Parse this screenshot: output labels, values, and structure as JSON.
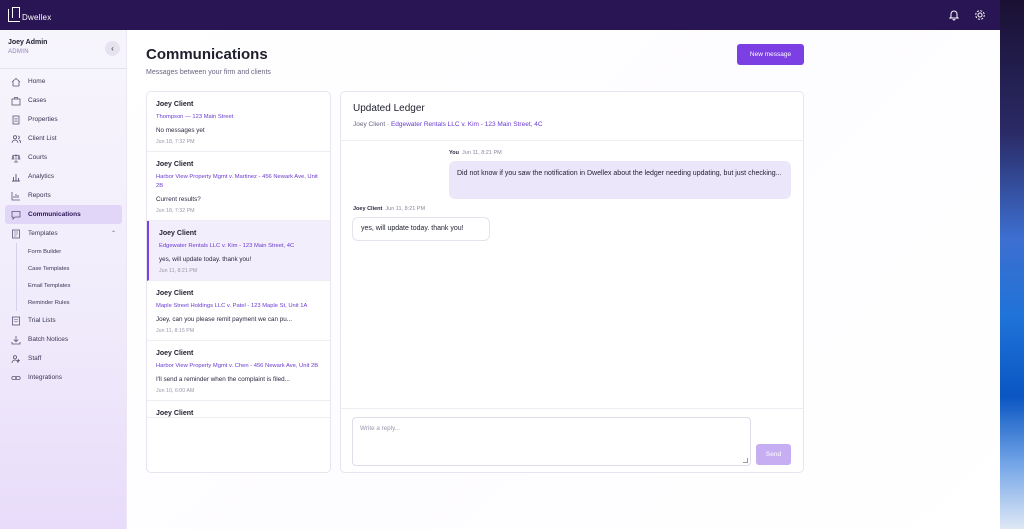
{
  "app": {
    "logo_text": "Dwellex"
  },
  "user": {
    "name": "Joey Admin",
    "role": "ADMIN"
  },
  "nav": {
    "items": [
      {
        "label": "Home",
        "icon": "home-icon"
      },
      {
        "label": "Cases",
        "icon": "briefcase-icon"
      },
      {
        "label": "Properties",
        "icon": "document-icon"
      },
      {
        "label": "Client List",
        "icon": "users-icon"
      },
      {
        "label": "Courts",
        "icon": "scale-icon"
      },
      {
        "label": "Analytics",
        "icon": "bar-chart-icon"
      },
      {
        "label": "Reports",
        "icon": "report-chart-icon"
      },
      {
        "label": "Communications",
        "icon": "chat-icon"
      },
      {
        "label": "Templates",
        "icon": "template-icon"
      }
    ],
    "sub_items": [
      "Form Builder",
      "Case Templates",
      "Email Templates",
      "Reminder Rules"
    ],
    "bottom_items": [
      {
        "label": "Trial Lists",
        "icon": "list-icon"
      },
      {
        "label": "Batch Notices",
        "icon": "download-icon"
      },
      {
        "label": "Staff",
        "icon": "staff-icon"
      },
      {
        "label": "Integrations",
        "icon": "link-icon"
      }
    ]
  },
  "page": {
    "title": "Communications",
    "subtitle": "Messages between your firm and clients",
    "new_message_label": "New message"
  },
  "threads": [
    {
      "name": "Joey Client",
      "case": "Thompson — 123 Main Street",
      "preview": "No messages yet",
      "time": "Jun 18, 7:32 PM"
    },
    {
      "name": "Joey Client",
      "case": "Harbor View Property Mgmt v. Martinez - 456 Newark Ave, Unit 2B",
      "preview": "Current results?",
      "time": "Jun 18, 7:32 PM"
    },
    {
      "name": "Joey Client",
      "case": "Edgewater Rentals LLC v. Kim - 123 Main Street, 4C",
      "preview": "yes, will update today. thank you!",
      "time": "Jun 11, 8:21 PM"
    },
    {
      "name": "Joey Client",
      "case": "Maple Street Holdings LLC v. Patel - 123 Maple St, Unit 1A",
      "preview": "Joey, can you please remit payment we can pu...",
      "time": "Jun 11, 8:15 PM"
    },
    {
      "name": "Joey Client",
      "case": "Harbor View Property Mgmt v. Chen - 456 Newark Ave, Unit 2B",
      "preview": "I'll send a reminder when the complaint is filed...",
      "time": "Jun 10, 6:00 AM"
    },
    {
      "name": "Joey Client",
      "case": "",
      "preview": "",
      "time": ""
    }
  ],
  "conversation": {
    "title": "Updated Ledger",
    "client": "Joey Client",
    "separator": " · ",
    "case": "Edgewater Rentals LLC v. Kim - 123 Main Street, 4C",
    "messages": [
      {
        "sender": "You",
        "time": "Jun 11, 8:21 PM",
        "text": "Did not know if you saw the notification in Dwellex about the ledger needing updating, but just checking..."
      },
      {
        "sender": "Joey Client",
        "time": "Jun 11, 8:21 PM",
        "text": "yes, will update today. thank you!"
      }
    ],
    "reply_placeholder": "Write a reply...",
    "send_label": "Send"
  },
  "colors": {
    "accent": "#7b3fe4",
    "topbar": "#2a1554",
    "link": "#6b3bd0"
  }
}
